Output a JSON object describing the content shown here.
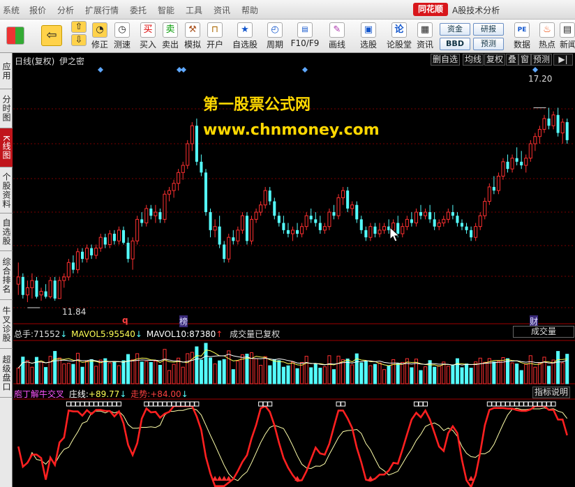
{
  "menubar": {
    "items": [
      "系统",
      "报价",
      "分析",
      "扩展行情",
      "委托",
      "智能",
      "工具",
      "资讯",
      "帮助"
    ],
    "brand": "同花顺",
    "app_title": "A股技术分析"
  },
  "toolbar": {
    "buttons": [
      {
        "label": "",
        "icon": "grid-icon"
      },
      {
        "label": "",
        "icon": "arrow-left-icon"
      },
      {
        "label": "",
        "icon": "arrow-up-down-icon"
      },
      {
        "label": "修正",
        "icon": "refresh-icon"
      },
      {
        "label": "测速",
        "icon": "clock-icon"
      },
      {
        "label": "买入",
        "icon": "buy-icon",
        "glyph": "买"
      },
      {
        "label": "卖出",
        "icon": "sell-icon",
        "glyph": "卖"
      },
      {
        "label": "模拟",
        "icon": "hammer-icon"
      },
      {
        "label": "开户",
        "icon": "lock-icon"
      },
      {
        "label": "自选股",
        "icon": "star-icon"
      },
      {
        "label": "周期",
        "icon": "cycle-icon"
      },
      {
        "label": "F10/F9",
        "icon": "f10-icon"
      },
      {
        "label": "画线",
        "icon": "pen-icon"
      },
      {
        "label": "选股",
        "icon": "monitor-icon"
      },
      {
        "label": "论股堂",
        "icon": "talk-icon",
        "glyph": "论"
      },
      {
        "label": "资讯",
        "icon": "doc-icon"
      },
      {
        "label": "数据",
        "icon": "pe-icon",
        "glyph": "PE"
      },
      {
        "label": "热点",
        "icon": "hot-icon"
      },
      {
        "label": "新闻",
        "icon": "news-icon"
      }
    ],
    "small_buttons": [
      "资金",
      "BBD",
      "研报",
      "预测"
    ]
  },
  "sidebar": {
    "tabs": [
      "应用",
      "分时图",
      "K线图",
      "个股资料",
      "自选股",
      "综合排名",
      "牛叉诊股",
      "超级盘口"
    ],
    "active": 2
  },
  "main_panel": {
    "title": "日线(复权)",
    "stock": "伊之密",
    "buttons": [
      "删自选",
      "均线",
      "复权",
      "叠",
      "窗",
      "预测"
    ],
    "high_label": "17.20",
    "low_label": "11.84",
    "markers": [
      "q",
      "榜",
      "财"
    ],
    "watermark_line1": "第一股票公式网",
    "watermark_line2": "www.chnmoney.com",
    "colors": {
      "up": "#ff3030",
      "down": "#54fcfc",
      "grid": "#7a0000"
    }
  },
  "volume_panel": {
    "total_label": "总手:",
    "total_value": "71552",
    "mavol5_label": "MAVOL5:",
    "mavol5_value": "95540",
    "mavol10_label": "MAVOL10:",
    "mavol10_value": "87380",
    "note": "成交量已复权",
    "dropdown": "成交量"
  },
  "indicator_panel": {
    "name": "庖丁解牛交叉",
    "zhuang_label": "庄线:",
    "zhuang_value": "+89.77",
    "trend_label": "走势:",
    "trend_value": "+84.00",
    "help": "指标说明"
  },
  "chart_data": {
    "type": "candlestick",
    "price_range": [
      11.2,
      18.1
    ],
    "candles": [
      [
        12.3,
        12.9,
        12.0,
        12.5
      ],
      [
        12.5,
        12.6,
        11.9,
        12.0
      ],
      [
        12.0,
        12.4,
        11.8,
        12.2
      ],
      [
        12.2,
        12.6,
        11.9,
        12.4
      ],
      [
        12.4,
        12.5,
        11.9,
        11.95
      ],
      [
        12.0,
        12.2,
        11.84,
        12.1
      ],
      [
        12.1,
        12.3,
        11.9,
        11.95
      ],
      [
        11.95,
        12.5,
        11.9,
        12.4
      ],
      [
        12.4,
        12.5,
        11.84,
        11.9
      ],
      [
        11.9,
        12.5,
        11.9,
        12.4
      ],
      [
        12.4,
        12.6,
        12.2,
        12.5
      ],
      [
        12.5,
        13.0,
        12.4,
        12.9
      ],
      [
        12.9,
        13.1,
        12.6,
        12.7
      ],
      [
        12.7,
        13.3,
        12.6,
        13.2
      ],
      [
        13.2,
        13.3,
        12.9,
        13.0
      ],
      [
        13.0,
        13.4,
        12.9,
        13.3
      ],
      [
        13.3,
        13.4,
        13.0,
        13.1
      ],
      [
        13.1,
        13.4,
        13.0,
        13.3
      ],
      [
        13.3,
        13.7,
        13.2,
        13.6
      ],
      [
        13.6,
        13.7,
        13.3,
        13.4
      ],
      [
        13.4,
        13.8,
        13.3,
        13.7
      ],
      [
        13.7,
        13.8,
        13.4,
        13.5
      ],
      [
        13.5,
        13.9,
        13.4,
        13.8
      ],
      [
        13.8,
        13.9,
        13.4,
        13.45
      ],
      [
        13.45,
        13.6,
        12.9,
        13.0
      ],
      [
        13.0,
        13.6,
        12.7,
        13.5
      ],
      [
        13.5,
        14.2,
        13.4,
        14.1
      ],
      [
        14.1,
        14.3,
        13.9,
        14.0
      ],
      [
        14.0,
        14.5,
        13.9,
        14.4
      ],
      [
        14.4,
        14.5,
        14.1,
        14.2
      ],
      [
        14.2,
        14.5,
        14.0,
        14.3
      ],
      [
        14.3,
        14.4,
        14.0,
        14.1
      ],
      [
        14.1,
        14.9,
        14.0,
        14.8
      ],
      [
        14.8,
        15.0,
        14.6,
        14.9
      ],
      [
        14.9,
        15.2,
        14.7,
        15.1
      ],
      [
        15.1,
        15.5,
        14.9,
        15.4
      ],
      [
        15.4,
        15.7,
        15.2,
        15.6
      ],
      [
        15.6,
        16.3,
        15.5,
        16.2
      ],
      [
        16.2,
        16.8,
        16.0,
        16.7
      ],
      [
        16.7,
        16.9,
        15.6,
        15.7
      ],
      [
        15.7,
        15.9,
        15.3,
        15.4
      ],
      [
        15.4,
        15.5,
        14.2,
        14.3
      ],
      [
        14.3,
        14.4,
        13.6,
        13.8
      ],
      [
        13.8,
        14.1,
        13.6,
        13.9
      ],
      [
        13.9,
        14.2,
        13.3,
        13.4
      ],
      [
        13.4,
        13.5,
        12.9,
        13.0
      ],
      [
        13.0,
        13.7,
        12.9,
        13.6
      ],
      [
        13.6,
        13.8,
        13.4,
        13.5
      ],
      [
        13.5,
        13.9,
        13.4,
        13.8
      ],
      [
        13.8,
        14.3,
        13.7,
        14.2
      ],
      [
        14.2,
        14.3,
        13.4,
        13.5
      ],
      [
        13.5,
        14.2,
        13.4,
        14.1
      ],
      [
        14.1,
        14.4,
        14.0,
        14.3
      ],
      [
        14.3,
        14.6,
        14.2,
        14.5
      ],
      [
        14.5,
        15.0,
        14.4,
        14.9
      ],
      [
        14.9,
        15.0,
        14.5,
        14.6
      ],
      [
        14.6,
        14.7,
        14.1,
        14.2
      ],
      [
        14.2,
        14.3,
        13.9,
        14.0
      ],
      [
        14.0,
        14.2,
        13.7,
        13.8
      ],
      [
        13.8,
        14.0,
        13.6,
        13.7
      ],
      [
        13.7,
        13.9,
        13.5,
        13.8
      ],
      [
        13.8,
        14.0,
        13.6,
        13.7
      ],
      [
        13.7,
        14.0,
        13.6,
        13.9
      ],
      [
        13.9,
        14.3,
        13.8,
        14.2
      ],
      [
        14.2,
        14.4,
        14.0,
        14.1
      ],
      [
        14.1,
        14.3,
        13.9,
        14.0
      ],
      [
        14.0,
        14.2,
        13.7,
        13.8
      ],
      [
        13.8,
        14.0,
        13.7,
        13.9
      ],
      [
        13.9,
        14.4,
        13.8,
        14.3
      ],
      [
        14.3,
        14.5,
        14.1,
        14.2
      ],
      [
        14.2,
        14.8,
        14.1,
        14.7
      ],
      [
        14.7,
        15.0,
        14.5,
        14.9
      ],
      [
        14.9,
        15.0,
        14.3,
        14.4
      ],
      [
        14.4,
        14.6,
        14.2,
        14.5
      ],
      [
        14.5,
        14.6,
        14.0,
        14.1
      ],
      [
        14.1,
        14.2,
        13.7,
        13.8
      ],
      [
        13.8,
        13.9,
        13.5,
        13.6
      ],
      [
        13.6,
        14.0,
        13.5,
        13.9
      ],
      [
        13.9,
        14.0,
        13.6,
        13.7
      ],
      [
        13.7,
        14.0,
        13.6,
        13.8
      ],
      [
        13.8,
        14.0,
        13.7,
        13.9
      ],
      [
        13.9,
        14.1,
        13.7,
        13.8
      ],
      [
        13.8,
        14.1,
        13.7,
        14.0
      ],
      [
        14.0,
        14.2,
        13.6,
        13.7
      ],
      [
        13.7,
        14.0,
        13.6,
        13.9
      ],
      [
        13.9,
        14.2,
        13.8,
        14.1
      ],
      [
        14.1,
        14.3,
        13.9,
        14.0
      ],
      [
        14.0,
        14.4,
        13.9,
        14.3
      ],
      [
        14.3,
        14.5,
        14.1,
        14.2
      ],
      [
        14.2,
        14.4,
        14.1,
        14.3
      ],
      [
        14.3,
        14.5,
        14.0,
        14.1
      ],
      [
        14.1,
        14.3,
        13.8,
        13.9
      ],
      [
        13.9,
        14.1,
        13.8,
        14.0
      ],
      [
        14.0,
        14.2,
        13.9,
        14.1
      ],
      [
        14.1,
        14.4,
        14.0,
        14.3
      ],
      [
        14.3,
        14.5,
        14.1,
        14.2
      ],
      [
        14.2,
        14.3,
        13.9,
        14.0
      ],
      [
        14.0,
        14.1,
        13.8,
        13.9
      ],
      [
        13.9,
        14.0,
        13.7,
        13.8
      ],
      [
        13.8,
        13.9,
        13.5,
        13.6
      ],
      [
        13.6,
        14.0,
        13.5,
        13.9
      ],
      [
        13.9,
        14.3,
        13.8,
        14.2
      ],
      [
        14.2,
        14.7,
        14.1,
        14.6
      ],
      [
        14.6,
        15.1,
        14.5,
        15.0
      ],
      [
        15.0,
        15.3,
        14.8,
        14.9
      ],
      [
        14.9,
        15.4,
        14.8,
        15.3
      ],
      [
        15.3,
        15.8,
        15.2,
        15.7
      ],
      [
        15.7,
        15.9,
        15.4,
        15.5
      ],
      [
        15.5,
        15.9,
        15.4,
        15.8
      ],
      [
        15.8,
        16.1,
        15.6,
        15.7
      ],
      [
        15.7,
        16.0,
        15.5,
        15.6
      ],
      [
        15.6,
        15.9,
        15.4,
        15.8
      ],
      [
        15.8,
        16.3,
        15.7,
        16.2
      ],
      [
        16.2,
        16.5,
        16.0,
        16.4
      ],
      [
        16.4,
        16.7,
        16.2,
        16.6
      ],
      [
        16.6,
        17.0,
        16.5,
        16.9
      ],
      [
        16.9,
        17.2,
        16.6,
        16.7
      ],
      [
        16.7,
        17.1,
        16.6,
        17.0
      ],
      [
        17.0,
        17.2,
        16.4,
        16.5
      ],
      [
        16.5,
        16.9,
        16.2,
        16.8
      ],
      [
        16.8,
        16.9,
        16.2,
        16.3
      ]
    ],
    "volume_ylim": [
      0,
      150000
    ],
    "indicator_ylim": [
      0,
      100
    ]
  }
}
